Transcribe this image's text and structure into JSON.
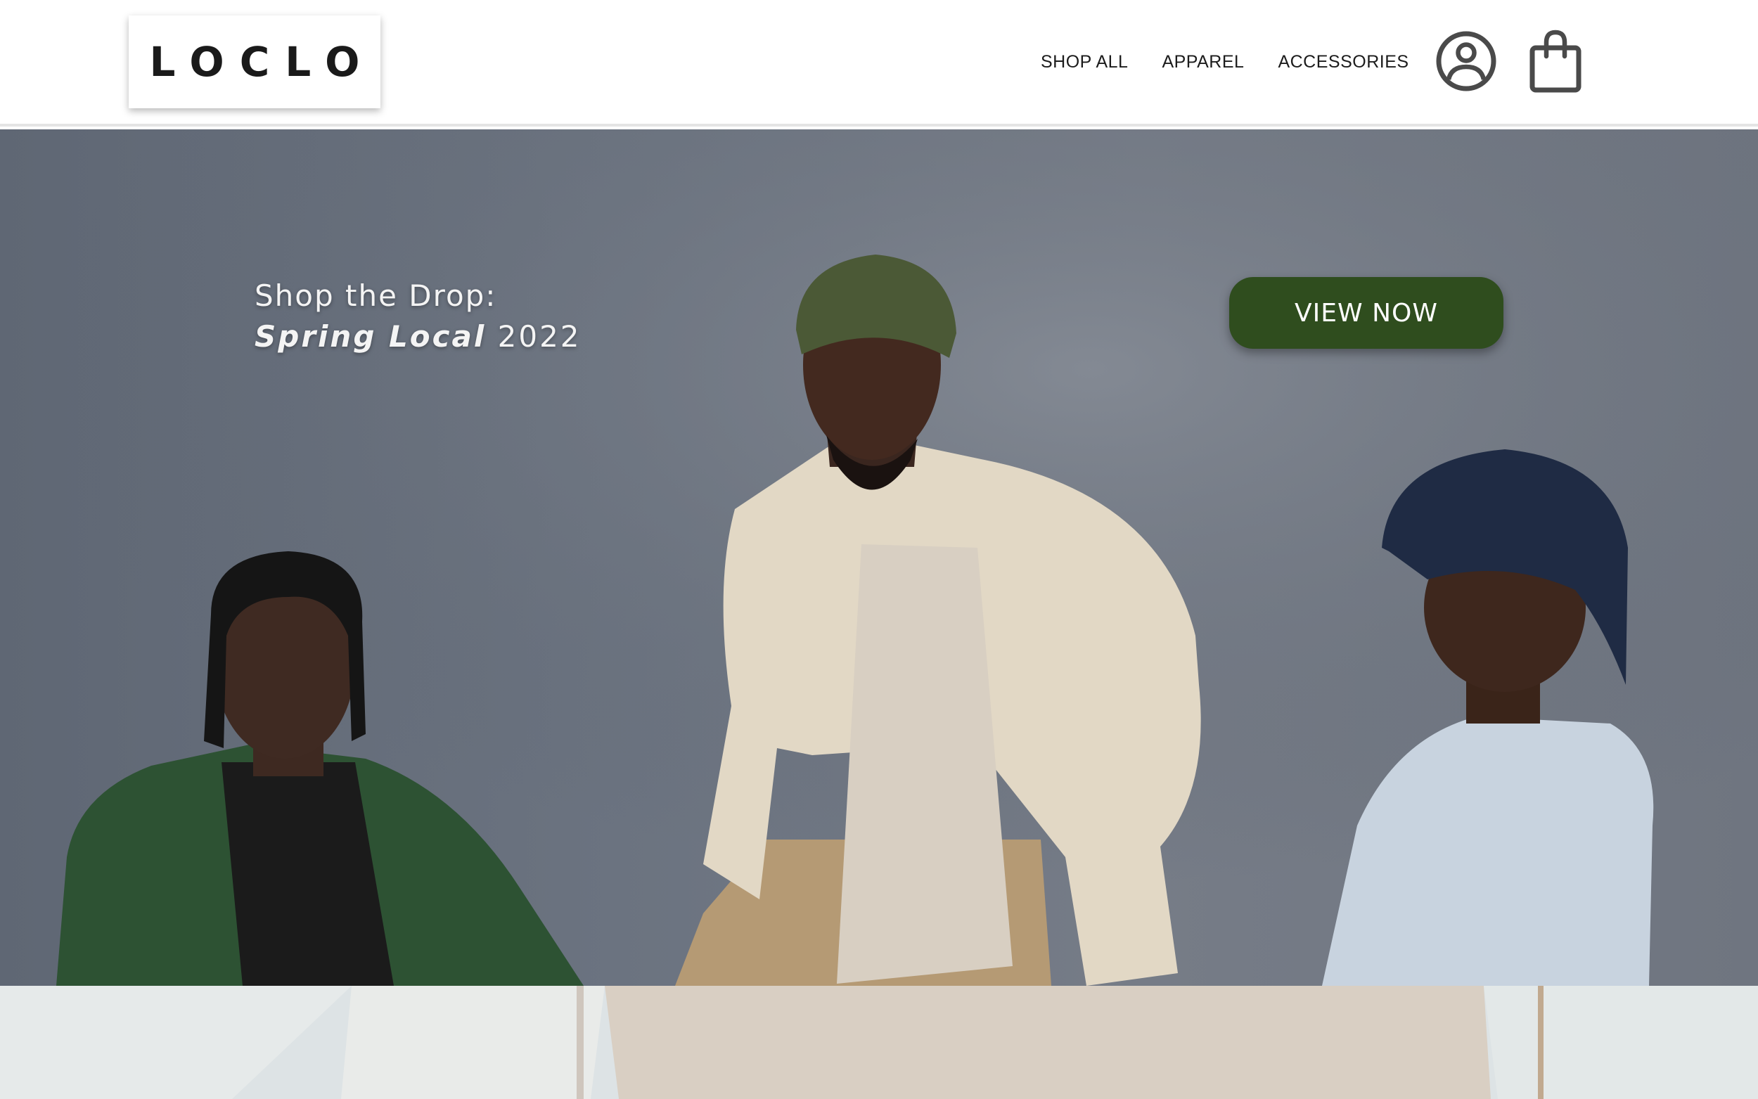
{
  "header": {
    "logo": "LOCLO",
    "nav": [
      {
        "label": "SHOP ALL"
      },
      {
        "label": "APPAREL"
      },
      {
        "label": "ACCESSORIES"
      }
    ],
    "icons": {
      "account": "user-circle-icon",
      "cart": "shopping-bag-icon"
    }
  },
  "hero": {
    "line1": "Shop the Drop:",
    "line2_emphasis": "Spring Local",
    "line2_year": "2022",
    "cta_label": "VIEW NOW"
  },
  "colors": {
    "cta": "#2f4d1e",
    "text_dark": "#1c1c1c",
    "hero_bg": "#6b7380",
    "header_bg": "#ffffff"
  }
}
